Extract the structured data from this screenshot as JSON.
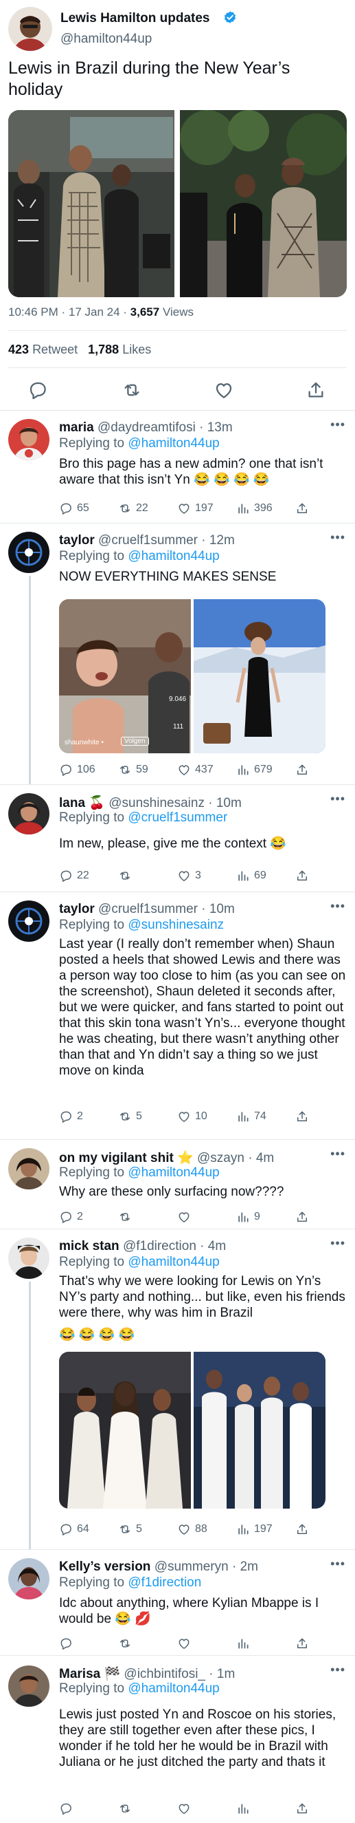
{
  "colors": {
    "accent": "#1d9bf0",
    "muted": "#536471",
    "text": "#0f1419",
    "divider": "#e4e8eb",
    "like_red": "#f91880"
  },
  "main_post": {
    "author_name": "Lewis Hamilton updates",
    "verified_icon": "verified-badge-icon",
    "handle": "@hamilton44up",
    "text": "Lewis in Brazil during the New Year’s holiday",
    "time": "10:46 PM · 17 Jan 24 ·",
    "views_count": "3,657",
    "views_label": "Views",
    "retweet_count": "423",
    "retweet_label": "Retweet",
    "likes_count": "1,788",
    "likes_label": "Likes",
    "actions": [
      "reply-icon",
      "retweet-icon",
      "like-icon",
      "share-icon"
    ]
  },
  "replies": [
    {
      "name": "maria",
      "handle": "@daydreamtifosi",
      "time": "· 13m",
      "replying_label": "Replying to",
      "replying_to": "@hamilton44up",
      "text": "Bro this page has a new admin? one that isn’t aware that this isn’t Yn 😂 😂 😂 😂",
      "counts": {
        "replies": "65",
        "retweets": "22",
        "likes": "197",
        "views": "396"
      }
    },
    {
      "name": "taylor",
      "handle": "@cruelf1summer",
      "time": "· 12m",
      "replying_label": "Replying to",
      "replying_to": "@hamilton44up",
      "text": "NOW EVERYTHING MAKES SENSE",
      "media_overlay": {
        "username": "shaunwhite •",
        "follow": "Volgen",
        "likes": "9.046",
        "comments": "111"
      },
      "counts": {
        "replies": "106",
        "retweets": "59",
        "likes": "437",
        "views": "679"
      }
    },
    {
      "name": "lana 🍒",
      "handle": "@sunshinesainz",
      "time": "· 10m",
      "replying_label": "Replying to",
      "replying_to": "@cruelf1summer",
      "text": "Im new, please, give me the context 😂",
      "counts": {
        "replies": "22",
        "retweets": "",
        "likes": "3",
        "views": "69"
      }
    },
    {
      "name": "taylor",
      "handle": "@cruelf1summer",
      "time": "· 10m",
      "replying_label": "Replying to",
      "replying_to": "@sunshinesainz",
      "text": "Last year (I really don’t remember when) Shaun posted a heels that showed Lewis and there was a person way too close to him (as you can see on the screenshot), Shaun deleted it seconds after, but we were quicker, and fans started to point out that this skin tona wasn’t Yn’s... everyone thought he was cheating, but there wasn’t anything other than that and Yn didn’t say a thing so we just move on kinda",
      "counts": {
        "replies": "2",
        "retweets": "5",
        "likes": "10",
        "views": "74"
      }
    },
    {
      "name": "on my vigilant shit ⭐",
      "handle": "@szayn",
      "time": "· 4m",
      "replying_label": "Replying to",
      "replying_to": "@hamilton44up",
      "text": "Why are these only surfacing now????",
      "counts": {
        "replies": "2",
        "retweets": "",
        "likes": "",
        "views": "9"
      }
    },
    {
      "name": "mick stan",
      "handle": "@f1direction",
      "time": "· 4m",
      "replying_label": "Replying to",
      "replying_to": "@hamilton44up",
      "text": "That’s why we were looking for Lewis on Yn’s NY’s party and nothing... but like, even his friends were there, why was him in Brazil",
      "text_emojis": "😂 😂 😂 😂",
      "counts": {
        "replies": "64",
        "retweets": "5",
        "likes": "88",
        "views": "197"
      }
    },
    {
      "name": "Kelly’s version",
      "handle": "@summeryn",
      "time": "· 2m",
      "replying_label": "Replying to",
      "replying_to": "@f1direction",
      "text": "Idc about anything, where Kylian Mbappe is I would be 😂 💋",
      "counts": {
        "replies": "",
        "retweets": "",
        "likes": "",
        "views": ""
      }
    },
    {
      "name": "Marisa 🏁",
      "handle": "@ichbintifosi_",
      "time": "· 1m",
      "replying_label": "Replying to",
      "replying_to": "@hamilton44up",
      "text": "Lewis just posted Yn and Roscoe on his stories, they are still together even after these pics, I wonder if he told her he would be in Brazil with Juliana or he just ditched the party and thats it",
      "counts": {
        "replies": "",
        "retweets": "",
        "likes": "",
        "views": ""
      }
    }
  ]
}
